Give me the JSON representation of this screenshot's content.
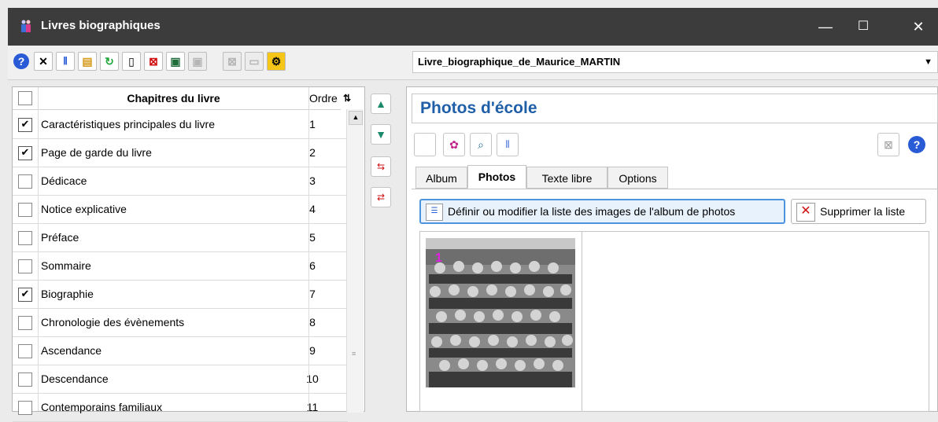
{
  "window": {
    "title": "Livres biographiques",
    "controls": {
      "minimize": "—",
      "maximize": "☐",
      "close": "✕"
    }
  },
  "toolbar": {
    "icons": [
      "help-icon",
      "tools-icon",
      "settings-sliders-icon",
      "open-folder-icon",
      "refresh-icon",
      "new-page-icon",
      "delete-icon",
      "save-icon",
      "save-disabled-icon",
      "close-disabled-icon",
      "minus-disabled-icon",
      "gear-icon"
    ],
    "book_select": {
      "value": "Livre_biographique_de_Maurice_MARTIN"
    }
  },
  "grid": {
    "header": {
      "chapters": "Chapitres du livre",
      "order": "Ordre"
    },
    "rows": [
      {
        "label": "Caractéristiques principales du livre",
        "order": "1",
        "checked": true
      },
      {
        "label": "Page de garde du livre",
        "order": "2",
        "checked": true
      },
      {
        "label": "Dédicace",
        "order": "3",
        "checked": false
      },
      {
        "label": "Notice explicative",
        "order": "4",
        "checked": false
      },
      {
        "label": "Préface",
        "order": "5",
        "checked": false
      },
      {
        "label": "Sommaire",
        "order": "6",
        "checked": false
      },
      {
        "label": "Biographie",
        "order": "7",
        "checked": true
      },
      {
        "label": "Chronologie des évènements",
        "order": "8",
        "checked": false
      },
      {
        "label": "Ascendance",
        "order": "9",
        "checked": false
      },
      {
        "label": "Descendance",
        "order": "10",
        "checked": false
      },
      {
        "label": "Contemporains familiaux",
        "order": "11",
        "checked": false
      }
    ],
    "check_mark": "✔"
  },
  "panel": {
    "title": "Photos d'école",
    "tabs": [
      "Album",
      "Photos",
      "Texte libre",
      "Options"
    ],
    "active_tab": "Photos",
    "define_button": "Définir ou modifier la liste des images de l'album de photos",
    "delete_button": "Supprimer la liste",
    "photo_number": "1"
  },
  "colors": {
    "titlebar": "#3c3c3c",
    "panel_title": "#1f5fa8",
    "accent_border": "#4e93e0",
    "photo_number": "#e020e0"
  }
}
